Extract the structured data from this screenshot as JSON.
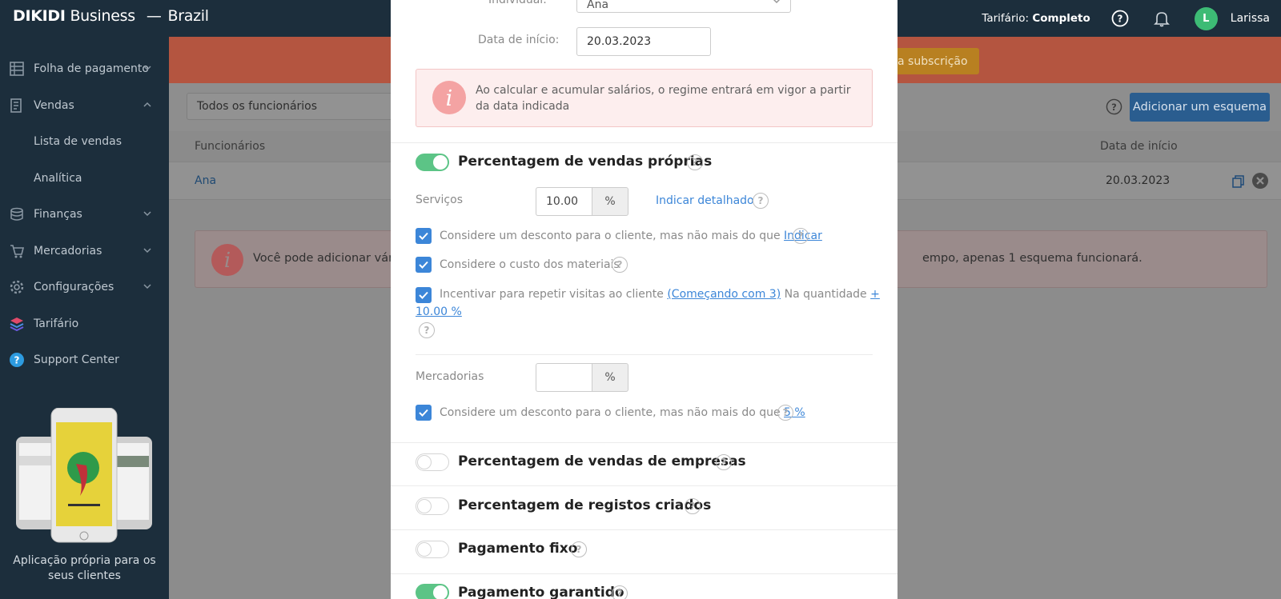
{
  "topbar": {
    "brand_bold": "DIKIDI",
    "brand_rest": "Business",
    "region": "Brazil",
    "tariff_label": "Tarifário:",
    "tariff_value": "Completo",
    "avatar_letter": "L",
    "username": "Larissa"
  },
  "sidebar": {
    "items": [
      {
        "label": "Folha de pagamento",
        "icon": "payroll-icon"
      },
      {
        "label": "Vendas",
        "icon": "sales-icon"
      },
      {
        "label": "Lista de vendas"
      },
      {
        "label": "Analítica"
      },
      {
        "label": "Finanças",
        "icon": "finance-icon"
      },
      {
        "label": "Mercadorias",
        "icon": "goods-icon"
      },
      {
        "label": "Configurações",
        "icon": "gear-icon"
      },
      {
        "label": "Tarifário",
        "icon": "layers-icon"
      },
      {
        "label": "Support Center",
        "icon": "support-icon"
      }
    ],
    "promo_text": "Aplicação própria para os seus clientes"
  },
  "main": {
    "subscription_button": "a subscrição",
    "employee_filter": "Todos os funcionários",
    "add_scheme_button": "Adicionar um esquema",
    "table": {
      "headers": [
        "Funcionários",
        "Data de início"
      ],
      "rows": [
        {
          "name": "Ana",
          "start": "20.03.2023"
        }
      ]
    },
    "info_left": "Você pode adicionar vária",
    "info_right": "empo, apenas 1 esquema funcionará."
  },
  "modal": {
    "individual_label": "Individual:",
    "individual_value": "Ana",
    "start_label": "Data de início:",
    "start_value": "20.03.2023",
    "note": "Ao calcular e acumular salários, o regime entrará em vigor a partir da data indicada",
    "own_sales": {
      "title": "Percentagem de vendas próprias",
      "services_label": "Serviços",
      "services_value": "10.00",
      "unit": "%",
      "detail_link": "Indicar detalhado",
      "discount_text": "Considere um desconto para o cliente, mas não mais do que",
      "discount_link": "Indicar",
      "materials_text": "Considere o custo dos materiais",
      "repeat_text": "Incentivar para repetir visitas ao cliente",
      "repeat_link": "(Começando com 3)",
      "quantity_text": "Na quantidade",
      "quantity_link_a": "+",
      "quantity_link_b": "10.00 %",
      "goods_label": "Mercadorias",
      "goods_value": "",
      "goods_discount_text": "Considere um desconto para o cliente, mas não mais do que",
      "goods_discount_link": "5 %"
    },
    "sections": [
      {
        "title": "Percentagem de vendas de empresas",
        "on": false
      },
      {
        "title": "Percentagem de registos criados",
        "on": false
      },
      {
        "title": "Pagamento fixo",
        "on": false
      },
      {
        "title": "Pagamento garantido",
        "on": true
      }
    ]
  },
  "colors": {
    "topbar": "#1c2e3c",
    "toggle_on": "#5cc486",
    "link": "#3c86d8",
    "checkbox": "#3c86d8",
    "avatar": "#3dbb75"
  }
}
